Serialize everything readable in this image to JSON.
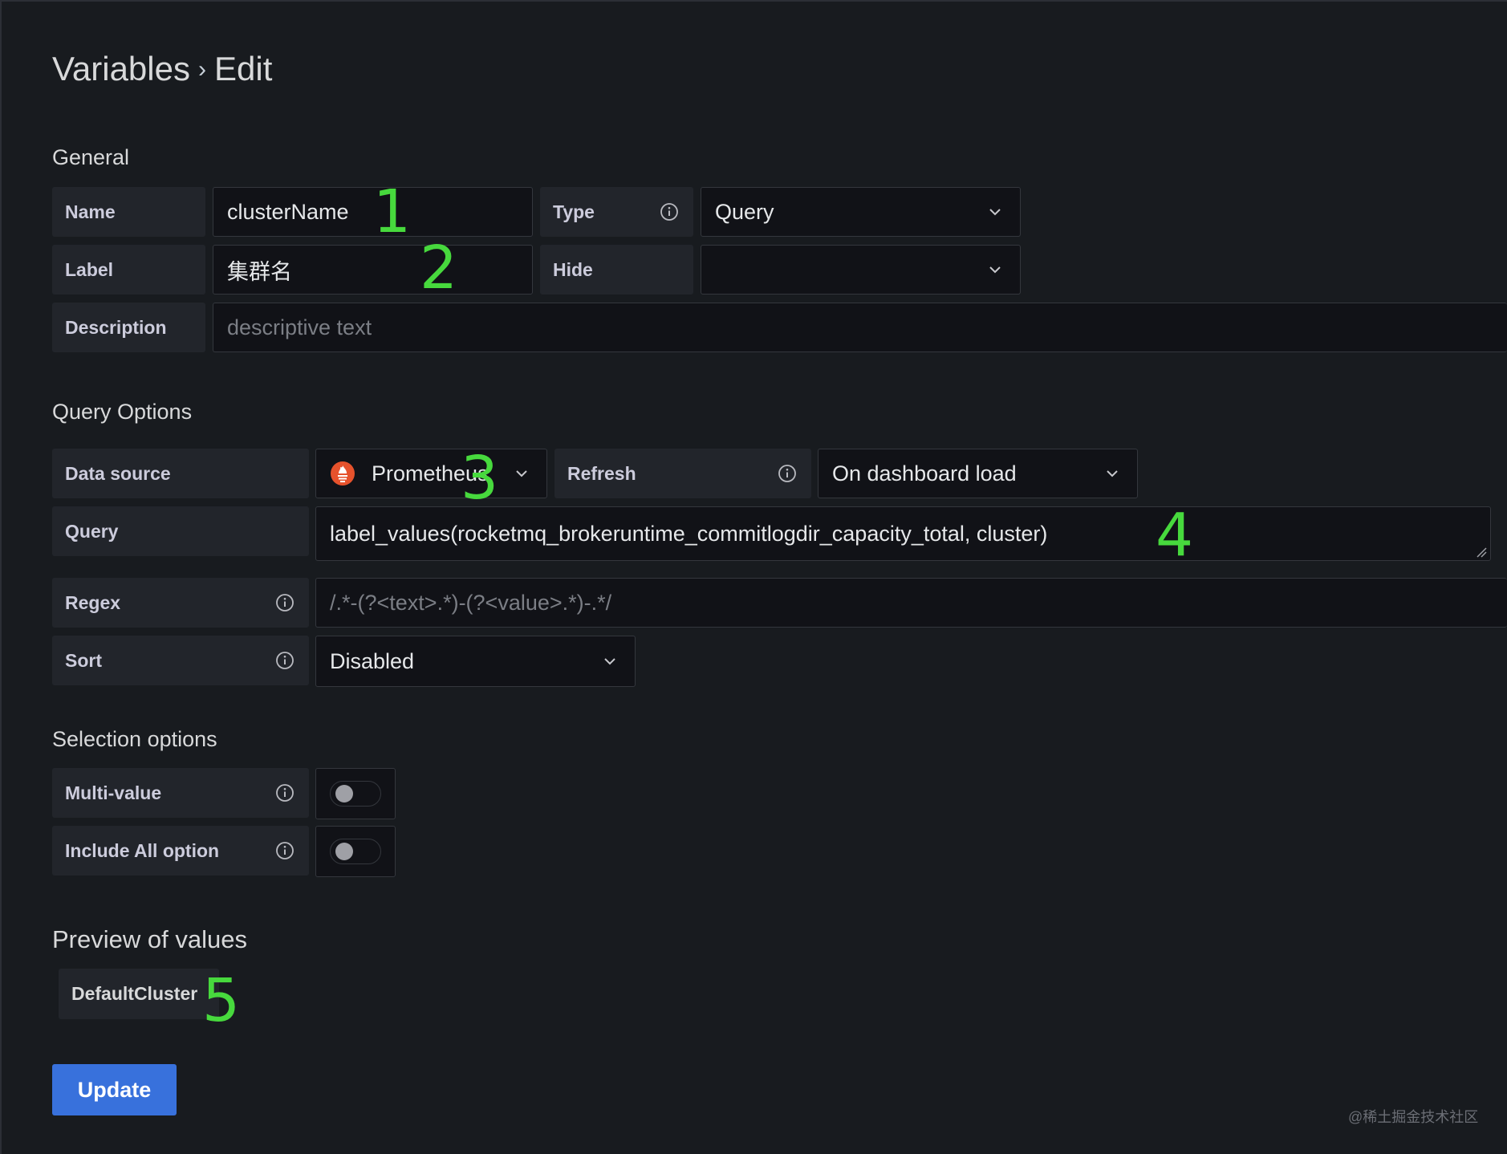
{
  "page": {
    "breadcrumb_parent": "Variables",
    "breadcrumb_separator": "›",
    "breadcrumb_current": "Edit"
  },
  "general": {
    "heading": "General",
    "name_label": "Name",
    "name_value": "clusterName",
    "type_label": "Type",
    "type_value": "Query",
    "label_label": "Label",
    "label_value": "集群名",
    "hide_label": "Hide",
    "hide_value": "",
    "description_label": "Description",
    "description_placeholder": "descriptive text"
  },
  "query_options": {
    "heading": "Query Options",
    "datasource_label": "Data source",
    "datasource_value": "Prometheus",
    "refresh_label": "Refresh",
    "refresh_value": "On dashboard load",
    "query_label": "Query",
    "query_value": "label_values(rocketmq_brokeruntime_commitlogdir_capacity_total, cluster)",
    "regex_label": "Regex",
    "regex_placeholder": "/.*-(?<text>.*)-(?<value>.*)-.*/",
    "sort_label": "Sort",
    "sort_value": "Disabled"
  },
  "selection_options": {
    "heading": "Selection options",
    "multi_value_label": "Multi-value",
    "multi_value_enabled": false,
    "include_all_label": "Include All option",
    "include_all_enabled": false
  },
  "preview": {
    "heading": "Preview of values",
    "values": [
      "DefaultCluster"
    ]
  },
  "actions": {
    "update_label": "Update"
  },
  "annotations": [
    "1",
    "2",
    "3",
    "4",
    "5"
  ],
  "watermark": "@稀土掘金技术社区",
  "colors": {
    "background": "#181b1f",
    "label_bg": "#22252b",
    "input_bg": "#111217",
    "border": "#34373d",
    "primary_button": "#3871dc",
    "annotation": "#47d93d",
    "prometheus_orange": "#e6522c"
  },
  "icons": [
    "info-icon",
    "chevron-down-icon",
    "prometheus-icon",
    "resize-handle-icon",
    "toggle-switch"
  ]
}
